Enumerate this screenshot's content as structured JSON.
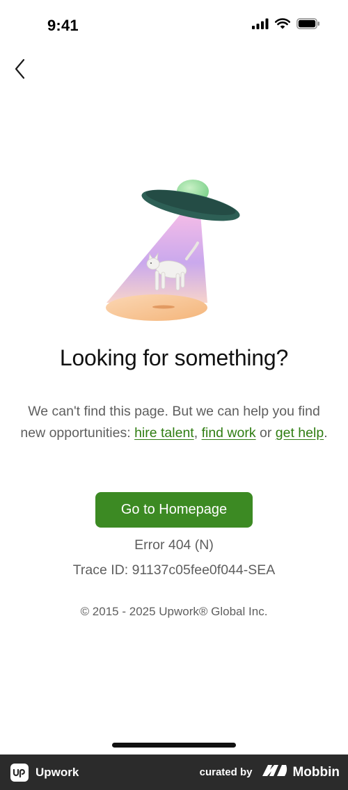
{
  "status_bar": {
    "time": "9:41"
  },
  "page": {
    "headline": "Looking for something?",
    "body_prefix": "We can't find this page. But we can help you find new opportunities: ",
    "link_hire": "hire talent",
    "sep_comma": ", ",
    "link_find": "find work",
    "sep_or": " or ",
    "link_help": "get help",
    "body_suffix": ".",
    "button_label": "Go to Homepage",
    "error_code": "Error 404 (N)",
    "trace_id": "Trace ID: 91137c05fee0f044-SEA",
    "copyright": "© 2015 - 2025 Upwork® Global Inc."
  },
  "footer": {
    "app_name": "Upwork",
    "app_icon_text": "up",
    "curated_by": "curated by",
    "brand": "Mobbin"
  },
  "colors": {
    "accent": "#3c8a23",
    "link": "#2f7d12",
    "text_muted": "#5e5e5e",
    "footer_bg": "#2b2b2b"
  }
}
